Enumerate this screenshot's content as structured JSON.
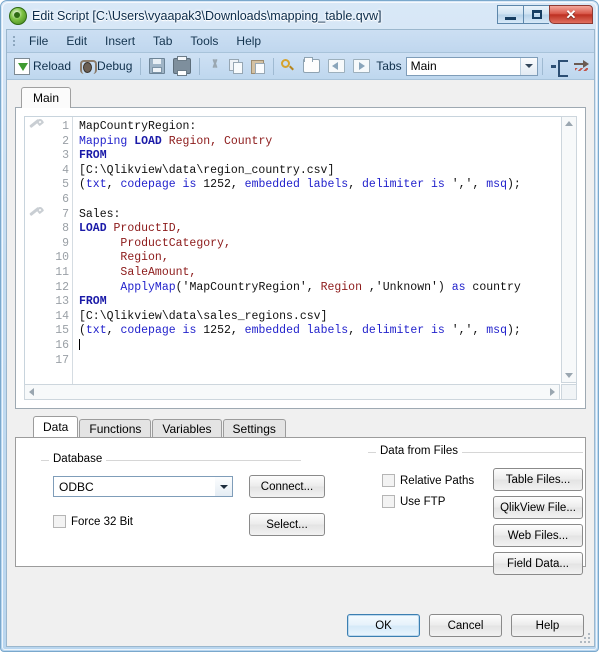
{
  "window": {
    "title": "Edit Script [C:\\Users\\vyaapak3\\Downloads\\mapping_table.qvw]",
    "app_icon": "qlikview-logo-icon",
    "buttons": {
      "minimize": "minimize-icon",
      "maximize": "maximize-icon",
      "close": "close-icon"
    }
  },
  "menubar": {
    "items": [
      {
        "label": "File"
      },
      {
        "label": "Edit"
      },
      {
        "label": "Insert"
      },
      {
        "label": "Tab"
      },
      {
        "label": "Tools"
      },
      {
        "label": "Help"
      }
    ]
  },
  "toolbar": {
    "reload_label": "Reload",
    "debug_label": "Debug",
    "tabs_label": "Tabs",
    "tabs_value": "Main",
    "icons": [
      "reload-icon",
      "debug-icon",
      "save-icon",
      "print-icon",
      "cut-icon",
      "copy-icon",
      "paste-icon",
      "search-icon",
      "open-folder-icon",
      "previous-tab-icon",
      "next-tab-icon",
      "tab-order-icon",
      "go-to-icon"
    ]
  },
  "script": {
    "tab_label": "Main",
    "lines": [
      {
        "n": "1",
        "marker": true,
        "tokens": [
          {
            "t": "MapCountryRegion:",
            "c": "plain"
          }
        ]
      },
      {
        "n": "2",
        "marker": false,
        "tokens": [
          {
            "t": "Mapping",
            "c": "fn"
          },
          {
            "t": " ",
            "c": "plain"
          },
          {
            "t": "LOAD",
            "c": "kw"
          },
          {
            "t": " ",
            "c": "plain"
          },
          {
            "t": "Region, Country",
            "c": "fld"
          }
        ]
      },
      {
        "n": "3",
        "marker": false,
        "tokens": [
          {
            "t": "FROM",
            "c": "kw"
          }
        ]
      },
      {
        "n": "4",
        "marker": false,
        "tokens": [
          {
            "t": "[C:\\Qlikview\\data\\region_country.csv]",
            "c": "plain"
          }
        ]
      },
      {
        "n": "5",
        "marker": false,
        "tokens": [
          {
            "t": "(",
            "c": "plain"
          },
          {
            "t": "txt",
            "c": "fn"
          },
          {
            "t": ", ",
            "c": "plain"
          },
          {
            "t": "codepage is",
            "c": "fn"
          },
          {
            "t": " 1252, ",
            "c": "plain"
          },
          {
            "t": "embedded labels",
            "c": "fn"
          },
          {
            "t": ", ",
            "c": "plain"
          },
          {
            "t": "delimiter is",
            "c": "fn"
          },
          {
            "t": " ',', ",
            "c": "plain"
          },
          {
            "t": "msq",
            "c": "fn"
          },
          {
            "t": ");",
            "c": "plain"
          }
        ]
      },
      {
        "n": "6",
        "marker": false,
        "tokens": [
          {
            "t": "",
            "c": "plain"
          }
        ]
      },
      {
        "n": "7",
        "marker": true,
        "tokens": [
          {
            "t": "Sales:",
            "c": "plain"
          }
        ]
      },
      {
        "n": "8",
        "marker": false,
        "tokens": [
          {
            "t": "LOAD",
            "c": "kw"
          },
          {
            "t": " ",
            "c": "plain"
          },
          {
            "t": "ProductID,",
            "c": "fld"
          }
        ]
      },
      {
        "n": "9",
        "marker": false,
        "tokens": [
          {
            "t": "      ",
            "c": "plain"
          },
          {
            "t": "ProductCategory,",
            "c": "fld"
          }
        ]
      },
      {
        "n": "10",
        "marker": false,
        "tokens": [
          {
            "t": "      ",
            "c": "plain"
          },
          {
            "t": "Region,",
            "c": "fld"
          }
        ]
      },
      {
        "n": "11",
        "marker": false,
        "tokens": [
          {
            "t": "      ",
            "c": "plain"
          },
          {
            "t": "SaleAmount,",
            "c": "fld"
          }
        ]
      },
      {
        "n": "12",
        "marker": false,
        "tokens": [
          {
            "t": "      ",
            "c": "plain"
          },
          {
            "t": "ApplyMap",
            "c": "fn"
          },
          {
            "t": "('MapCountryRegion', ",
            "c": "plain"
          },
          {
            "t": "Region",
            "c": "fld"
          },
          {
            "t": " ,'Unknown') ",
            "c": "plain"
          },
          {
            "t": "as",
            "c": "fn"
          },
          {
            "t": " country",
            "c": "plain"
          }
        ]
      },
      {
        "n": "13",
        "marker": false,
        "tokens": [
          {
            "t": "FROM",
            "c": "kw"
          }
        ]
      },
      {
        "n": "14",
        "marker": false,
        "tokens": [
          {
            "t": "[C:\\Qlikview\\data\\sales_regions.csv]",
            "c": "plain"
          }
        ]
      },
      {
        "n": "15",
        "marker": false,
        "tokens": [
          {
            "t": "(",
            "c": "plain"
          },
          {
            "t": "txt",
            "c": "fn"
          },
          {
            "t": ", ",
            "c": "plain"
          },
          {
            "t": "codepage is",
            "c": "fn"
          },
          {
            "t": " 1252, ",
            "c": "plain"
          },
          {
            "t": "embedded labels",
            "c": "fn"
          },
          {
            "t": ", ",
            "c": "plain"
          },
          {
            "t": "delimiter is",
            "c": "fn"
          },
          {
            "t": " ',', ",
            "c": "plain"
          },
          {
            "t": "msq",
            "c": "fn"
          },
          {
            "t": ");",
            "c": "plain"
          }
        ]
      },
      {
        "n": "16",
        "marker": false,
        "caret": true,
        "tokens": [
          {
            "t": "",
            "c": "plain"
          }
        ]
      },
      {
        "n": "17",
        "marker": false,
        "tokens": [
          {
            "t": "",
            "c": "plain"
          }
        ]
      }
    ]
  },
  "panel": {
    "tabs": [
      {
        "label": "Data",
        "active": true
      },
      {
        "label": "Functions",
        "active": false
      },
      {
        "label": "Variables",
        "active": false
      },
      {
        "label": "Settings",
        "active": false
      }
    ],
    "database": {
      "group_title": "Database",
      "source_value": "ODBC",
      "connect_label": "Connect...",
      "select_label": "Select...",
      "force32_label": "Force 32 Bit",
      "force32_checked": false
    },
    "files": {
      "group_title": "Data from Files",
      "relative_paths_label": "Relative Paths",
      "relative_paths_checked": false,
      "use_ftp_label": "Use FTP",
      "use_ftp_checked": false,
      "buttons": [
        {
          "label": "Table Files..."
        },
        {
          "label": "QlikView File..."
        },
        {
          "label": "Web Files..."
        },
        {
          "label": "Field Data..."
        }
      ]
    }
  },
  "footer": {
    "ok_label": "OK",
    "cancel_label": "Cancel",
    "help_label": "Help"
  },
  "colors": {
    "keyword": "#1a1aa8",
    "function": "#2222cc",
    "field": "#8c1a1a",
    "accent": "#3c7fb1",
    "title_bar": "#c3dcf2",
    "close_button": "#bd3022"
  }
}
